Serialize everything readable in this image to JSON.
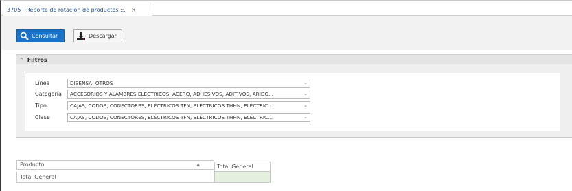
{
  "tab": {
    "title": "3705 - Reporte de rotación de productos ::.",
    "close": "×"
  },
  "toolbar": {
    "consultar_label": "Consultar",
    "descargar_label": "Descargar"
  },
  "filtros": {
    "title": "Filtros",
    "fields": [
      {
        "label": "Línea",
        "value": "DISENSA, OTROS"
      },
      {
        "label": "Categoría",
        "value": "ACCESORIOS Y ALAMBRES ELECTRICOS, ACERO, ADHESIVOS, ADITIVOS, ARIDO..."
      },
      {
        "label": "Tipo",
        "value": "CAJAS, CODOS, CONECTORES, ELÉCTRICOS TFN, ELÉCTRICOS THHN, ELÉCTRIC..."
      },
      {
        "label": "Clase",
        "value": "CAJAS, CODOS, CONECTORES, ELÉCTRICOS TFN, ELÉCTRICOS THHN, ELÉCTRIC..."
      }
    ]
  },
  "grid": {
    "row_header": "Producto",
    "column_header": "Total General",
    "total_row_label": "Total General"
  },
  "colors": {
    "accent": "#1a73c8",
    "total_cell": "#e3f0df"
  },
  "icons": {
    "consultar": "search-icon",
    "descargar": "download-icon",
    "filtros": "chevron-up-icon",
    "sort": "sort-asc-icon",
    "dropdown": "chevron-down-icon"
  }
}
